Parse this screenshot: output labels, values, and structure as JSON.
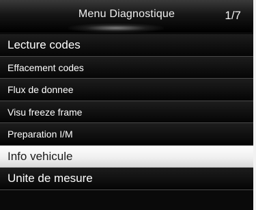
{
  "header": {
    "title": "Menu Diagnostique",
    "page_indicator": "1/7"
  },
  "menu": {
    "items": [
      {
        "label": "Lecture codes"
      },
      {
        "label": "Effacement codes"
      },
      {
        "label": "Flux de donnee"
      },
      {
        "label": "Visu freeze frame"
      },
      {
        "label": "Preparation I/M"
      },
      {
        "label": "Info vehicule"
      },
      {
        "label": "Unite de mesure"
      }
    ],
    "selected_label": "Info vehicule"
  },
  "colors": {
    "background": "#0a0a0a",
    "item_text": "#ffffff",
    "selected_background": "#f2f2f2",
    "selected_text": "#1a1a1a",
    "divider": "#4a4a4a"
  }
}
